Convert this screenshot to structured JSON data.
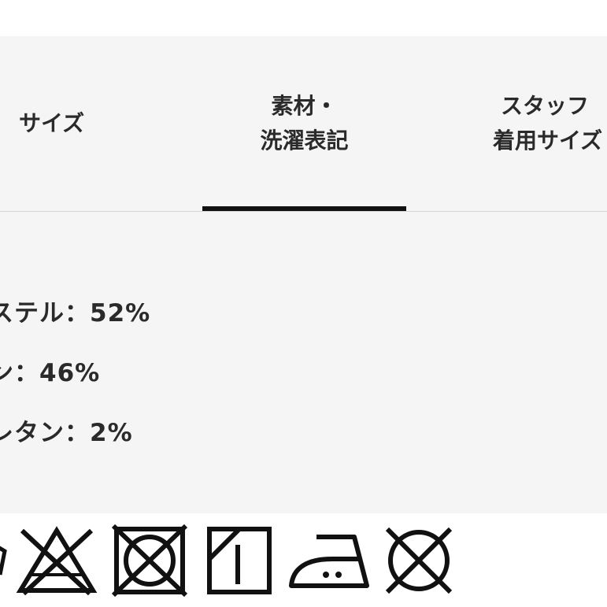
{
  "tabs": [
    {
      "label_lines": [
        "サイズ"
      ],
      "active": false
    },
    {
      "label_lines": [
        "素材・",
        "洗濯表記"
      ],
      "active": true
    },
    {
      "label_lines": [
        "スタッフ",
        "着用サイズ"
      ],
      "active": false
    }
  ],
  "materials": [
    "ステル：52%",
    "ン：46%",
    "レタン：2%"
  ],
  "care_icons": [
    "bleach-prohibited-icon",
    "tumble-dry-prohibited-icon",
    "line-dry-icon",
    "iron-low-temp-icon",
    "dry-clean-prohibited-icon"
  ],
  "colors": {
    "panel_bg": "#f5f5f5",
    "text": "#222222",
    "underline": "#111111",
    "divider": "#d6d6d6"
  }
}
